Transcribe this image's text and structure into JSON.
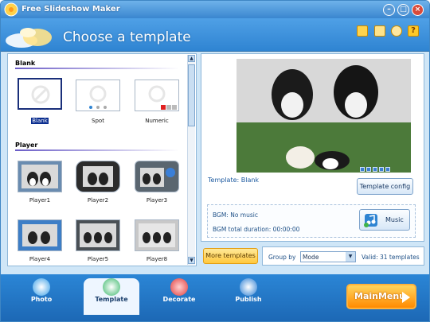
{
  "window": {
    "title": "Free Slideshow Maker"
  },
  "header": {
    "title": "Choose a template"
  },
  "left": {
    "sections": [
      {
        "title": "Blank",
        "items": [
          "Blank",
          "Spot",
          "Numeric"
        ]
      },
      {
        "title": "Player",
        "items": [
          "Player1",
          "Player2",
          "Player3",
          "Player4",
          "Player5",
          "Player8"
        ]
      }
    ],
    "selected": "Blank"
  },
  "preview": {
    "template_label": "Template:",
    "template_name": "Blank"
  },
  "buttons": {
    "template_config": "Template config",
    "music": "Music",
    "more_templates": "More templates",
    "main_menu": "MainMenu"
  },
  "bgm": {
    "line1": "BGM: No music",
    "line2": "BGM total duration: 00:00:00"
  },
  "toolbar": {
    "group_by_label": "Group by",
    "group_by_value": "Mode",
    "valid_text": "Valid: 31 templates"
  },
  "tabs": [
    "Photo",
    "Template",
    "Decorate",
    "Publish"
  ],
  "active_tab": "Template",
  "colors": {
    "accent": "#2f84d2",
    "selection": "#0a2d8f",
    "mainmenu": "#ff8a00"
  }
}
